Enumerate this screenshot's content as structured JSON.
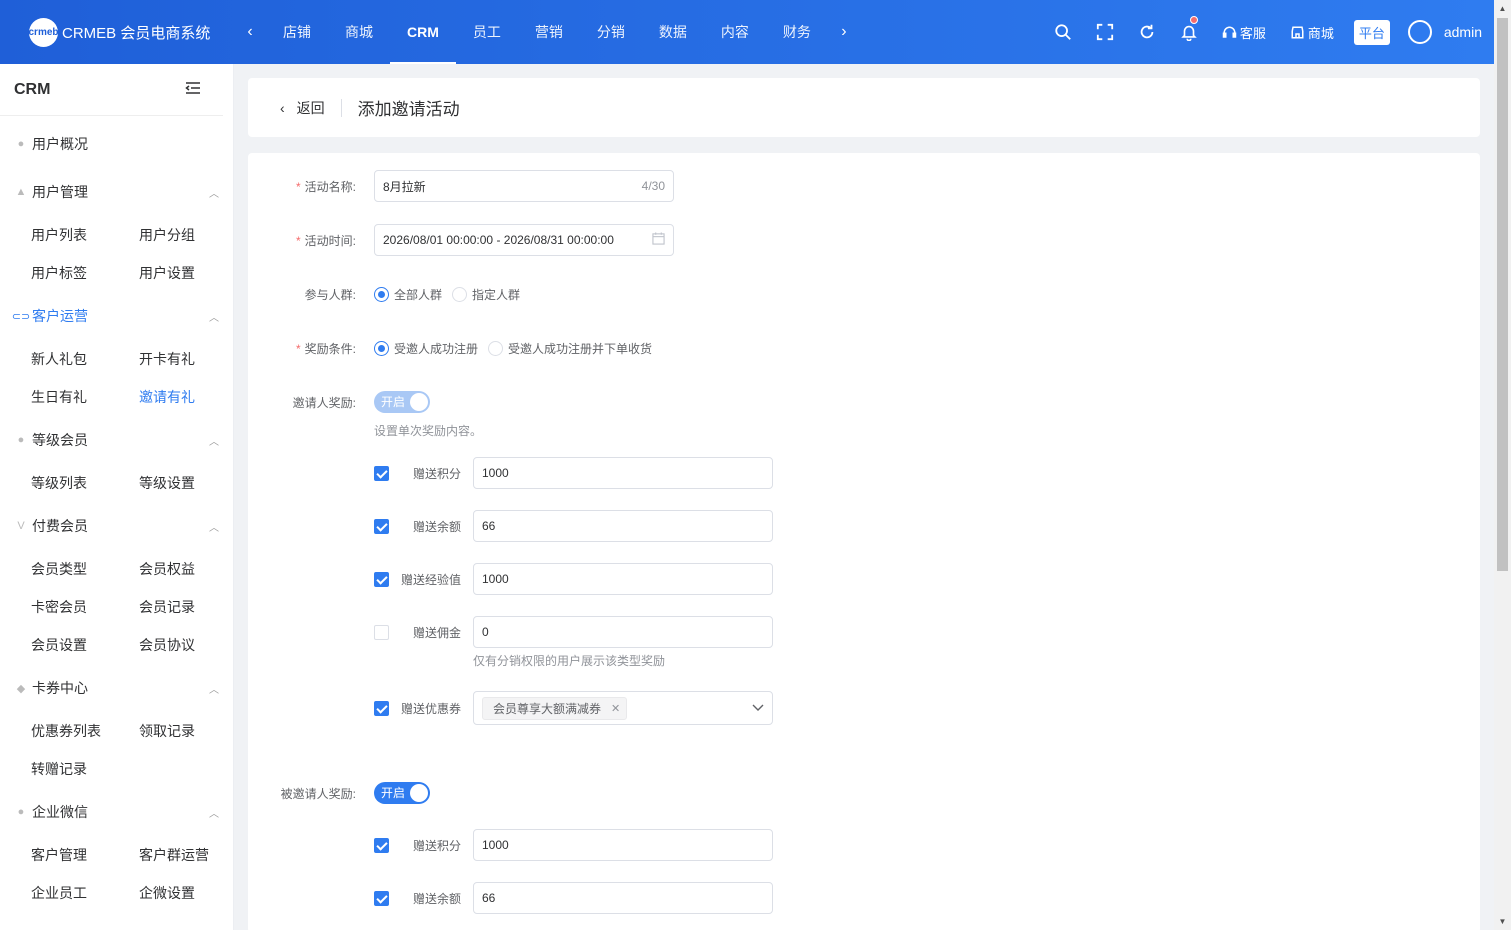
{
  "header": {
    "logo_mark": "crmeb",
    "logo_text": "CRMEB 会员电商系统",
    "nav": [
      "店铺",
      "商城",
      "CRM",
      "员工",
      "营销",
      "分销",
      "数据",
      "内容",
      "财务"
    ],
    "nav_active_index": 2,
    "service_label": "客服",
    "mall_label": "商城",
    "platform_label": "平台",
    "username": "admin"
  },
  "sidebar": {
    "title": "CRM",
    "groups": [
      {
        "label": "用户概况",
        "icon": "user-circle-icon",
        "items": []
      },
      {
        "label": "用户管理",
        "icon": "user-icon",
        "items": [
          "用户列表",
          "用户分组",
          "用户标签",
          "用户设置"
        ]
      },
      {
        "label": "客户运营",
        "icon": "link-icon",
        "active": true,
        "items": [
          "新人礼包",
          "开卡有礼",
          "生日有礼",
          "邀请有礼"
        ]
      },
      {
        "label": "等级会员",
        "icon": "level-icon",
        "items": [
          "等级列表",
          "等级设置"
        ]
      },
      {
        "label": "付费会员",
        "icon": "vip-icon",
        "items": [
          "会员类型",
          "会员权益",
          "卡密会员",
          "会员记录",
          "会员设置",
          "会员协议"
        ]
      },
      {
        "label": "卡券中心",
        "icon": "coupon-icon",
        "items": [
          "优惠券列表",
          "领取记录",
          "转赠记录"
        ]
      },
      {
        "label": "企业微信",
        "icon": "wechat-icon",
        "items": [
          "客户管理",
          "客户群运营",
          "企业员工",
          "企微设置"
        ]
      }
    ]
  },
  "page": {
    "back_label": "返回",
    "title": "添加邀请活动"
  },
  "form": {
    "name_label": "活动名称:",
    "name_value": "8月拉新",
    "name_count": "4/30",
    "time_label": "活动时间:",
    "time_value": "2026/08/01 00:00:00 - 2026/08/31 00:00:00",
    "audience_label": "参与人群:",
    "audience_options": [
      "全部人群",
      "指定人群"
    ],
    "condition_label": "奖励条件:",
    "condition_options": [
      "受邀人成功注册",
      "受邀人成功注册并下单收货"
    ],
    "inviter_label": "邀请人奖励:",
    "inviter_toggle": "开启",
    "inviter_hint": "设置单次奖励内容。",
    "inviter_rewards": [
      {
        "label": "赠送积分",
        "value": "1000",
        "checked": true
      },
      {
        "label": "赠送余额",
        "value": "66",
        "checked": true
      },
      {
        "label": "赠送经验值",
        "value": "1000",
        "checked": true
      },
      {
        "label": "赠送佣金",
        "value": "0",
        "checked": false
      }
    ],
    "commission_hint": "仅有分销权限的用户展示该类型奖励",
    "coupon_label": "赠送优惠券",
    "coupon_tag": "会员尊享大额满减券",
    "invitee_label": "被邀请人奖励:",
    "invitee_toggle": "开启",
    "invitee_rewards": [
      {
        "label": "赠送积分",
        "value": "1000",
        "checked": true
      },
      {
        "label": "赠送余额",
        "value": "66",
        "checked": true
      }
    ]
  },
  "colors": {
    "primary": "#2f7cf0",
    "required": "#f56c6c"
  }
}
